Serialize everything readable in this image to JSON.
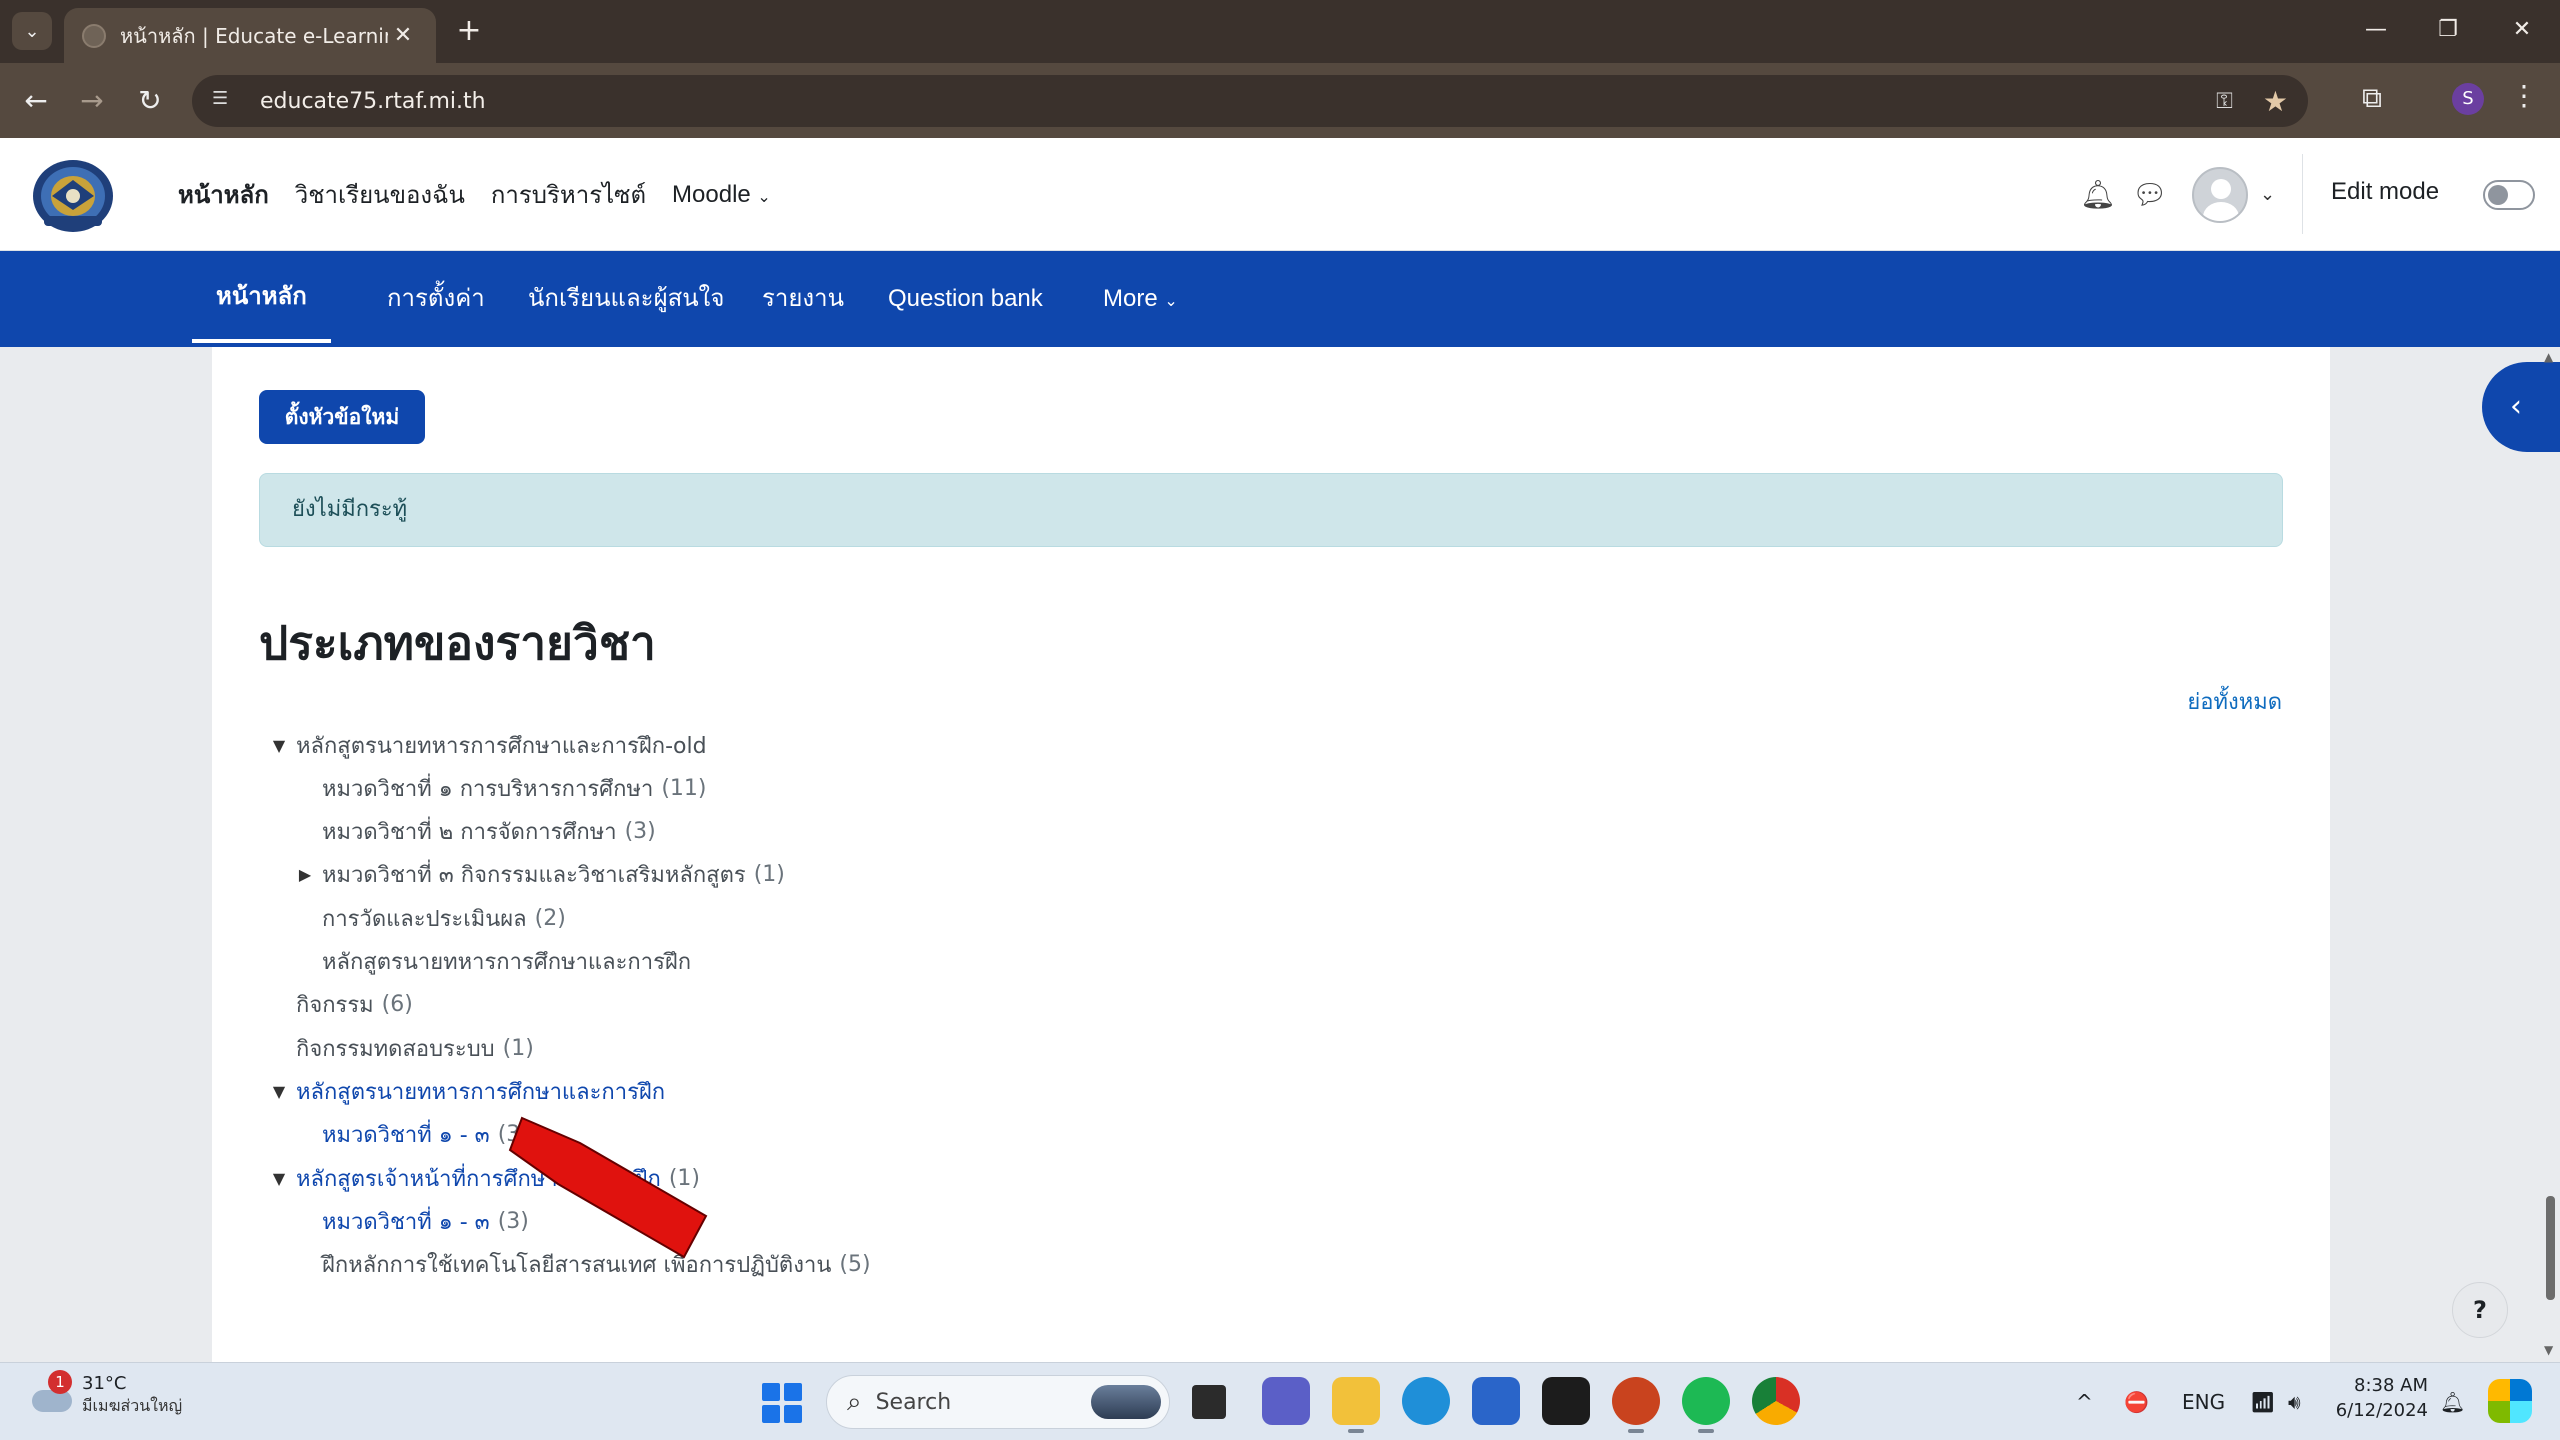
{
  "browser": {
    "tab_title": "หน้าหลัก | Educate e-Learning",
    "url": "educate75.rtaf.mi.th",
    "profile_initial": "S"
  },
  "navbar": {
    "primary": [
      "หน้าหลัก",
      "วิชาเรียนของฉัน",
      "การบริหารไซต์",
      "Moodle"
    ],
    "edit_mode_label": "Edit mode"
  },
  "secondary_nav": [
    "หน้าหลัก",
    "การตั้งค่า",
    "นักเรียนและผู้สนใจ",
    "รายงาน",
    "Question bank",
    "More"
  ],
  "page": {
    "new_topic_button": "ตั้งหัวข้อใหม่",
    "no_topics_alert": "ยังไม่มีกระทู้",
    "section_title": "ประเภทของรายวิชา",
    "collapse_all": "ย่อทั้งหมด"
  },
  "categories": [
    {
      "name": "หลักสูตรนายทหารการศึกษาและการฝึก-old",
      "count": "",
      "level": 0,
      "expand": "open",
      "link": false
    },
    {
      "name": "หมวดวิชาที่ ๑ การบริหารการศึกษา",
      "count": "(11)",
      "level": 1,
      "expand": "",
      "link": false
    },
    {
      "name": "หมวดวิชาที่ ๒ การจัดการศึกษา",
      "count": "(3)",
      "level": 1,
      "expand": "",
      "link": false
    },
    {
      "name": "หมวดวิชาที่ ๓ กิจกรรมและวิชาเสริมหลักสูตร",
      "count": "(1)",
      "level": 1,
      "expand": "closed",
      "link": false
    },
    {
      "name": "การวัดและประเมินผล",
      "count": "(2)",
      "level": 1,
      "expand": "",
      "link": false
    },
    {
      "name": "หลักสูตรนายทหารการศึกษาและการฝึก",
      "count": "",
      "level": 1,
      "expand": "",
      "link": false
    },
    {
      "name": "กิจกรรม",
      "count": "(6)",
      "level": 0,
      "expand": "",
      "link": false
    },
    {
      "name": "กิจกรรมทดสอบระบบ",
      "count": "(1)",
      "level": 0,
      "expand": "",
      "link": false
    },
    {
      "name": "หลักสูตรนายทหารการศึกษาและการฝึก",
      "count": "",
      "level": 0,
      "expand": "open",
      "link": true
    },
    {
      "name": "หมวดวิชาที่ ๑ - ๓",
      "count": "(3)",
      "level": 1,
      "expand": "",
      "link": true
    },
    {
      "name": "หลักสูตรเจ้าหน้าที่การศึกษาและการฝึก",
      "count": "(1)",
      "level": 0,
      "expand": "open",
      "link": true
    },
    {
      "name": "หมวดวิชาที่ ๑ - ๓",
      "count": "(3)",
      "level": 1,
      "expand": "",
      "link": true
    },
    {
      "name": "ฝึกหลักการใช้เทคโนโลยีสารสนเทศ เพื่อการปฏิบัติงาน",
      "count": "(5)",
      "level": 1,
      "expand": "",
      "link": false
    }
  ],
  "taskbar": {
    "weather_temp": "31°C",
    "weather_cond": "มีเมฆส่วนใหญ่",
    "weather_badge": "1",
    "search_placeholder": "Search",
    "language": "ENG",
    "time": "8:38 AM",
    "date": "6/12/2024"
  },
  "colors": {
    "brand_blue": "#0f47ad",
    "link_blue": "#0f6cbf",
    "alert_bg": "#cfe6ea",
    "annotation_arrow": "#e0120e"
  }
}
